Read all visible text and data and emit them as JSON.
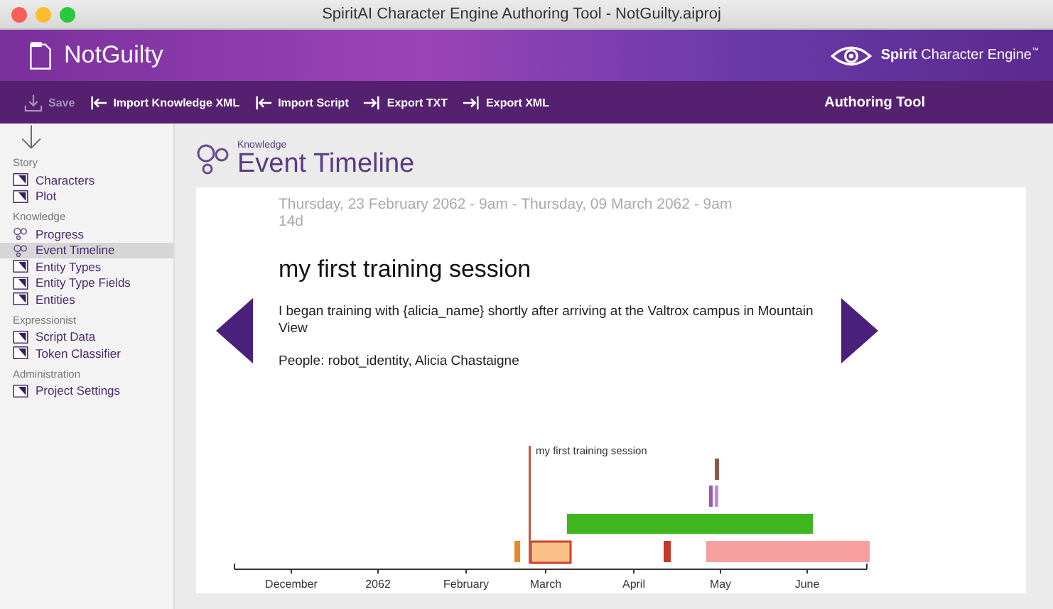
{
  "window": {
    "title": "SpiritAI Character Engine Authoring Tool - NotGuilty.aiproj"
  },
  "header": {
    "project": "NotGuilty",
    "brand_bold": "Spirit",
    "brand": "Character Engine",
    "brand_mark": "™"
  },
  "toolbar": {
    "items": [
      {
        "label": "Save",
        "kind": "save",
        "disabled": true
      },
      {
        "label": "Import Knowledge XML",
        "kind": "import",
        "disabled": false
      },
      {
        "label": "Import Script",
        "kind": "import",
        "disabled": false
      },
      {
        "label": "Export TXT",
        "kind": "export",
        "disabled": false
      },
      {
        "label": "Export XML",
        "kind": "export",
        "disabled": false
      }
    ],
    "right_label": "Authoring Tool"
  },
  "sidebar": {
    "sections": [
      {
        "title": "Story",
        "items": [
          {
            "label": "Characters",
            "kind": "doc",
            "selected": false
          },
          {
            "label": "Plot",
            "kind": "doc",
            "selected": false
          }
        ]
      },
      {
        "title": "Knowledge",
        "items": [
          {
            "label": "Progress",
            "kind": "circles",
            "selected": false
          },
          {
            "label": "Event Timeline",
            "kind": "circles",
            "selected": true
          },
          {
            "label": "Entity Types",
            "kind": "doc",
            "selected": false
          },
          {
            "label": "Entity Type Fields",
            "kind": "doc",
            "selected": false
          },
          {
            "label": "Entities",
            "kind": "doc",
            "selected": false
          }
        ]
      },
      {
        "title": "Expressionist",
        "items": [
          {
            "label": "Script Data",
            "kind": "doc",
            "selected": false
          },
          {
            "label": "Token Classifier",
            "kind": "doc",
            "selected": false
          }
        ]
      },
      {
        "title": "Administration",
        "items": [
          {
            "label": "Project Settings",
            "kind": "doc",
            "selected": false
          }
        ]
      }
    ]
  },
  "page": {
    "section": "Knowledge",
    "title": "Event Timeline"
  },
  "event": {
    "dates": "Thursday, 23 February 2062 - 9am - Thursday, 09 March 2062 - 9am",
    "duration": "14d",
    "title": "my first training session",
    "description": "I began training with {alicia_name} shortly after arriving at the Valtrox campus in Mountain View",
    "people": "People: robot_identity, Alicia Chastaigne"
  },
  "timeline": {
    "marker_label": "my first training session",
    "months": [
      "December",
      "2062",
      "February",
      "March",
      "April",
      "May",
      "June"
    ]
  }
}
